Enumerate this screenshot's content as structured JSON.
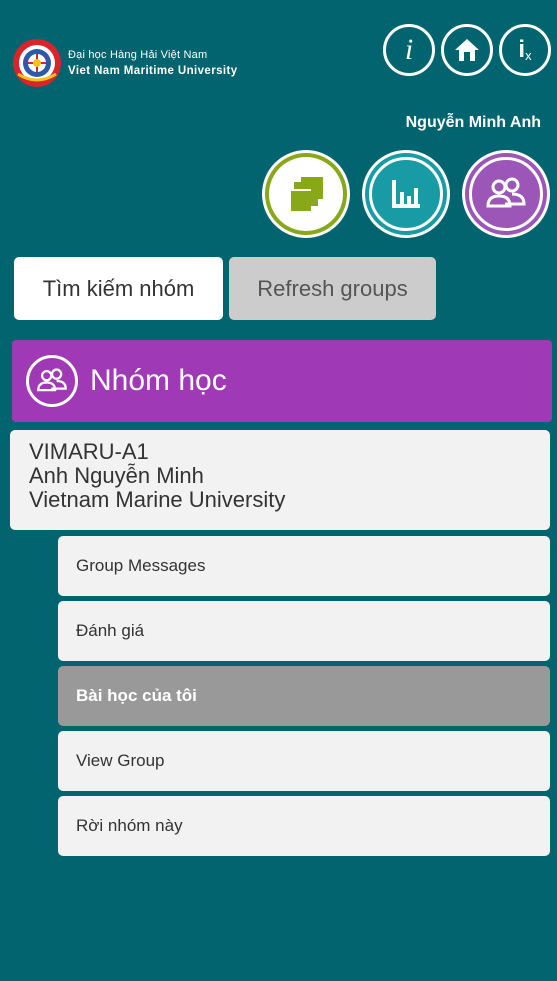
{
  "header": {
    "logo_vn": "Đại học Hàng Hải Việt Nam",
    "logo_en": "Viet Nam Maritime University",
    "icons": [
      "info-icon",
      "home-icon",
      "info-close-icon"
    ],
    "username": "Nguyễn Minh Anh"
  },
  "quick_nav": {
    "icons": [
      "courses-icon",
      "reports-icon",
      "groups-icon"
    ]
  },
  "buttons": {
    "search": "Tìm kiếm nhóm",
    "refresh": "Refresh groups"
  },
  "group_section": {
    "title": "Nhóm học",
    "icon": "group-icon"
  },
  "group_card": {
    "name": "VIMARU-A1",
    "owner": "Anh Nguyễn Minh",
    "institution": "Vietnam Marine University"
  },
  "menu": [
    {
      "label": "Group Messages"
    },
    {
      "label": "Đánh giá"
    },
    {
      "label": "Bài học của tôi"
    },
    {
      "label": "View Group"
    },
    {
      "label": "Rời nhóm này"
    }
  ],
  "colors": {
    "background": "#01646f",
    "group_header": "#a039b6",
    "active_menu": "#999999",
    "green_icon": "#88a81a",
    "teal_icon": "#199ba5",
    "purple_icon": "#9b56b7"
  }
}
